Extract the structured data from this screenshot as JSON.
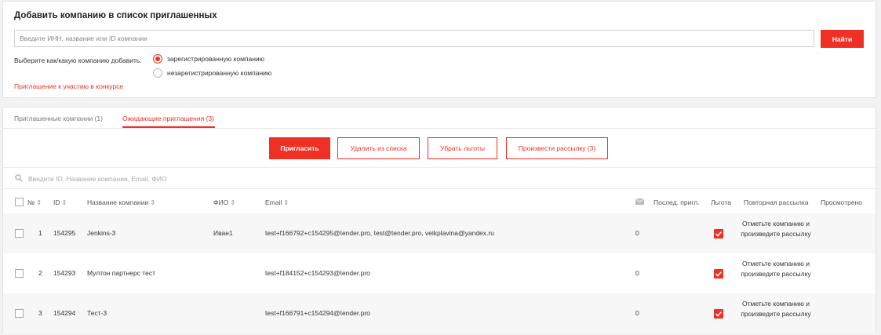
{
  "add_panel": {
    "title": "Добавить компанию в список приглашенных",
    "search_placeholder": "Введите ИНН, название или ID компании",
    "find_button": "Найти",
    "choose_label": "Выберите как/какую компанию добавить:",
    "radio_registered": "зарегистрированную компанию",
    "radio_unregistered": "незарегистрированную компанию",
    "selected_radio": "registered",
    "invite_link": "Приглашение к участию в конкурсе"
  },
  "tabs": [
    {
      "label": "Приглашенные компании (1)",
      "active": false
    },
    {
      "label": "Ожидающие приглашения (3)",
      "active": true
    }
  ],
  "actions": {
    "invite": "Пригласить",
    "remove": "Удалить из списка",
    "remove_benefits": "Убрать льготы",
    "send_mailing": "Произвести рассылку (3)"
  },
  "filter_placeholder": "Введите ID, Название компании, Email, ФИО",
  "columns": {
    "num": "№",
    "id": "ID",
    "company": "Название компании",
    "fio": "ФИО",
    "email": "Email",
    "last_invite": "Послед. пригл.",
    "benefit": "Льгота",
    "repeat": "Повторная рассылка",
    "viewed": "Просмотрено"
  },
  "rows": [
    {
      "num": "1",
      "id": "154295",
      "company": "Jenkins-3",
      "fio": "Иван1",
      "email": "test+f166792+c154295@tender.pro, test@tender.pro, veikplavina@yandex.ru",
      "count": "0",
      "benefit": true,
      "repeat": "Отметьте компанию и произведите рассылку",
      "viewed": ""
    },
    {
      "num": "2",
      "id": "154293",
      "company": "Мултон партнерс тест",
      "fio": "",
      "email": "test+f184152+c154293@tender.pro",
      "count": "0",
      "benefit": true,
      "repeat": "Отметьте компанию и произведите рассылку",
      "viewed": ""
    },
    {
      "num": "3",
      "id": "154294",
      "company": "Тест-3",
      "fio": "",
      "email": "test+f166791+c154294@tender.pro",
      "count": "0",
      "benefit": true,
      "repeat": "Отметьте компанию и произведите рассылку",
      "viewed": ""
    }
  ],
  "colors": {
    "accent": "#ee3124",
    "stripe": "#f7f7f7"
  }
}
